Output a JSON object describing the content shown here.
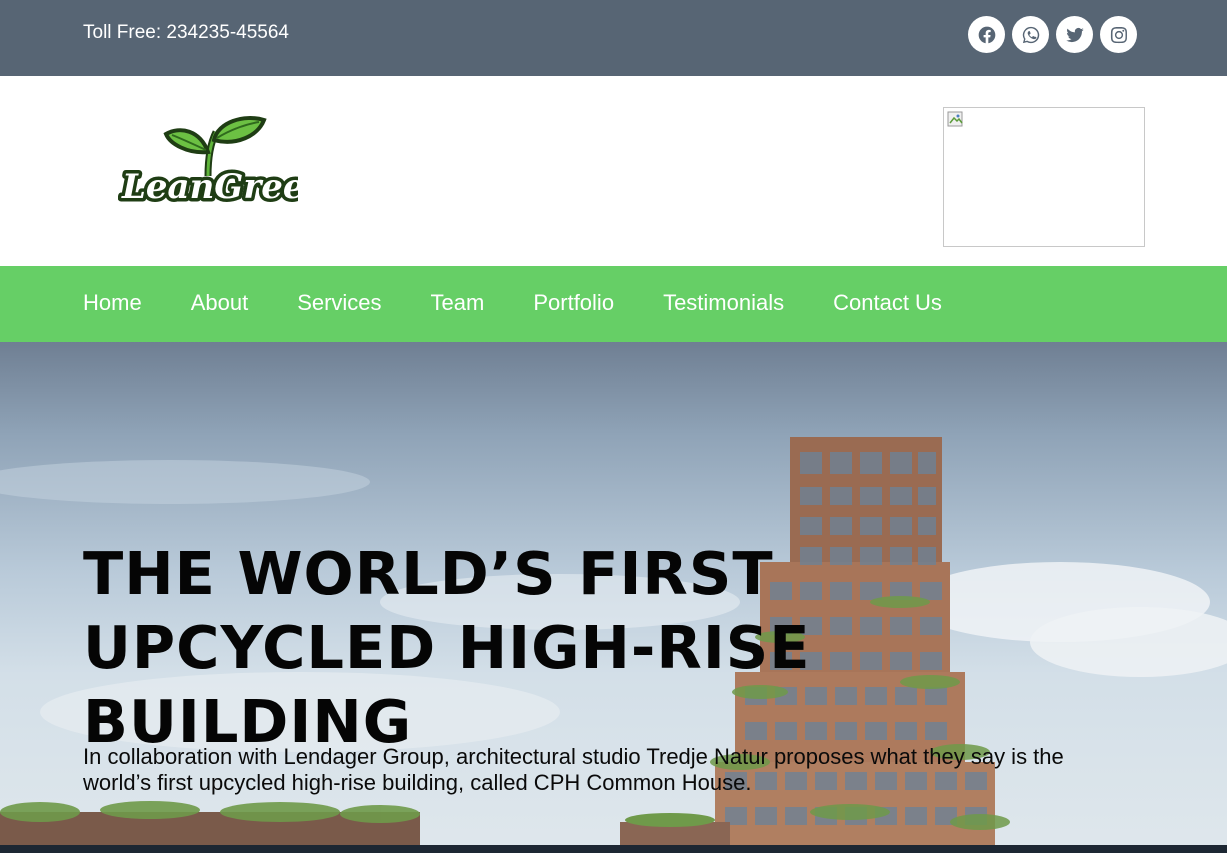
{
  "topbar": {
    "toll_free": "Toll Free: 234235-45564",
    "socials": [
      "facebook-icon",
      "whatsapp-icon",
      "twitter-icon",
      "instagram-icon"
    ],
    "background": "#576574"
  },
  "header": {
    "logo_text": "LeanGreen"
  },
  "nav": {
    "background": "#66cf66",
    "items": [
      {
        "label": "Home"
      },
      {
        "label": "About"
      },
      {
        "label": "Services"
      },
      {
        "label": "Team"
      },
      {
        "label": "Portfolio"
      },
      {
        "label": "Testimonials"
      },
      {
        "label": "Contact Us"
      }
    ]
  },
  "hero": {
    "title": "THE WORLD’S FIRST UPCYCLED HIGH-RISE BUILDING",
    "text": "In collaboration with Lendager Group, architectural studio Tredje Natur proposes what they say is the world’s first upcycled high-rise building, called CPH Common House."
  }
}
